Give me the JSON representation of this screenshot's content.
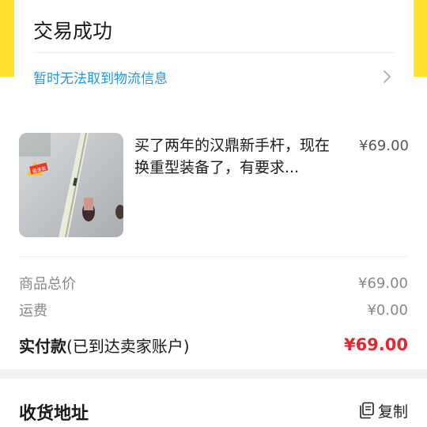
{
  "status": {
    "title": "交易成功",
    "logistics_text": "暂时无法取到物流信息"
  },
  "item": {
    "title": "买了两年的汉鼎新手杆，现在换重型装备了，有要求...",
    "price": "¥69.00",
    "thumb_badge": "极速卖"
  },
  "fees": {
    "goods_total_label": "商品总价",
    "goods_total_value": "¥69.00",
    "shipping_label": "运费",
    "shipping_value": "¥0.00",
    "paid_label": "实付款",
    "paid_note": "(已到达卖家账户)",
    "paid_value": "¥69.00"
  },
  "address": {
    "title": "收货地址",
    "copy_label": "复制"
  },
  "colors": {
    "brand_yellow": "#ffe12e",
    "link_blue": "#2196e0",
    "price_red": "#e6262b"
  },
  "icons": [
    "chevron-right-icon",
    "copy-icon"
  ]
}
